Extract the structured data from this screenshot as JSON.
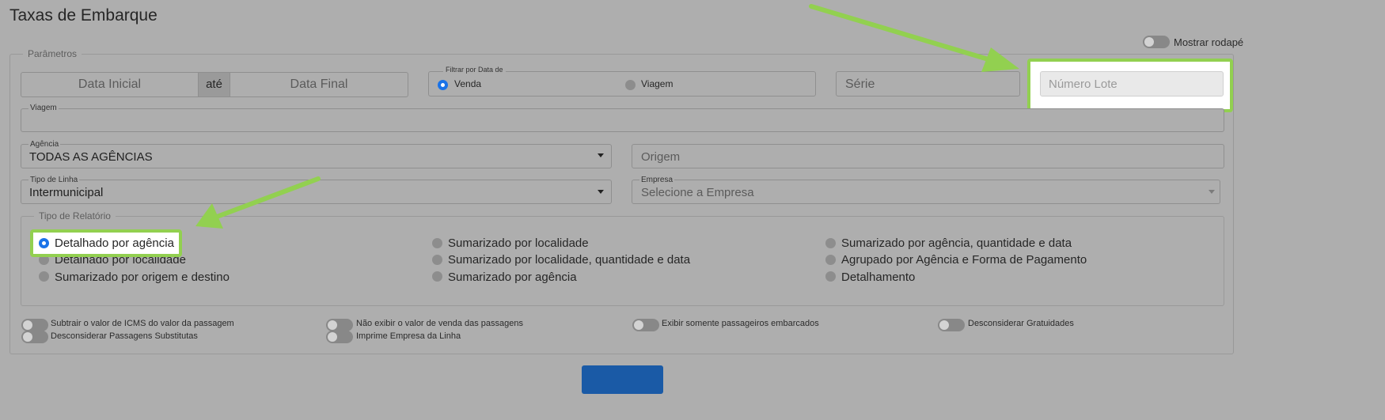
{
  "page": {
    "title": "Taxas de Embarque"
  },
  "footer_toggle": {
    "label": "Mostrar rodapé"
  },
  "params": {
    "legend": "Parâmetros",
    "date_range": {
      "start_placeholder": "Data Inicial",
      "separator": "até",
      "end_placeholder": "Data Final"
    },
    "date_filter": {
      "label": "Filtrar por Data de",
      "options": [
        "Venda",
        "Viagem"
      ],
      "selected": "Venda"
    },
    "serie": {
      "placeholder": "Série"
    },
    "lote": {
      "placeholder": "Número Lote"
    },
    "viagem": {
      "label": "Viagem",
      "value": ""
    },
    "agencia": {
      "label": "Agência",
      "value": "TODAS AS AGÊNCIAS"
    },
    "origem": {
      "placeholder": "Origem"
    },
    "tipo_linha": {
      "label": "Tipo de Linha",
      "value": "Intermunicipal"
    },
    "empresa": {
      "label": "Empresa",
      "placeholder": "Selecione a Empresa"
    }
  },
  "report_type": {
    "legend": "Tipo de Relatório",
    "selected": "Detalhado por agência",
    "col1": [
      "Detalhado por agência",
      "Detalhado por localidade",
      "Sumarizado por origem e destino"
    ],
    "col2": [
      "Sumarizado por localidade",
      "Sumarizado por localidade, quantidade e data",
      "Sumarizado por agência"
    ],
    "col3": [
      "Sumarizado por agência, quantidade e data",
      "Agrupado por Agência e Forma de Pagamento",
      "Detalhamento"
    ]
  },
  "options": {
    "subtrair_icms": "Subtrair o valor de ICMS do valor da passagem",
    "desconsiderar_substitutas": "Desconsiderar Passagens Substitutas",
    "nao_exibir_venda": "Não exibir o valor de venda das passagens",
    "imprime_empresa": "Imprime Empresa da Linha",
    "somente_embarcados": "Exibir somente passageiros embarcados",
    "desconsiderar_gratuidades": "Desconsiderar Gratuidades"
  },
  "annotation_color": "#92d050",
  "accent_color": "#1a73e8"
}
